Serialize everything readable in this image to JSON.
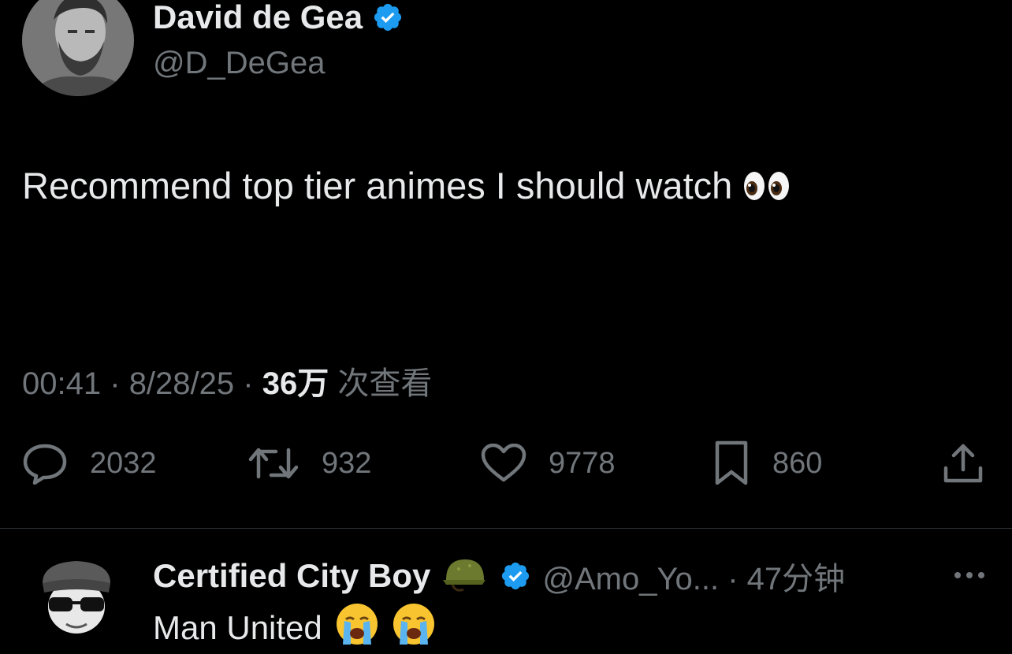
{
  "tweet": {
    "author": {
      "name": "David de Gea",
      "handle": "@D_DeGea",
      "verified": true
    },
    "text": "Recommend top tier animes I should watch",
    "emoji": "eyes-emoji",
    "meta": {
      "time": "00:41",
      "separator": "·",
      "date": "8/28/25",
      "views_count": "36万",
      "views_label": "次查看"
    },
    "actions": {
      "replies": "2032",
      "retweets": "932",
      "likes": "9778",
      "bookmarks": "860"
    }
  },
  "reply": {
    "author": {
      "name": "Certified City Boy",
      "name_emoji": "military-helmet-emoji",
      "verified": true
    },
    "handle_time": "@Amo_Yo... · 47分钟",
    "text": "Man United",
    "emojis": [
      "crying-face-emoji",
      "crying-face-emoji"
    ]
  },
  "colors": {
    "background": "#000000",
    "text_primary": "#e7e9ea",
    "text_secondary": "#71767b",
    "verified_blue": "#1d9bf0",
    "divider": "#2f3336"
  },
  "icons": {
    "reply": "speech-bubble-icon",
    "retweet": "retweet-icon",
    "like": "heart-icon",
    "bookmark": "bookmark-icon",
    "share": "share-icon",
    "more": "more-dots-icon"
  }
}
